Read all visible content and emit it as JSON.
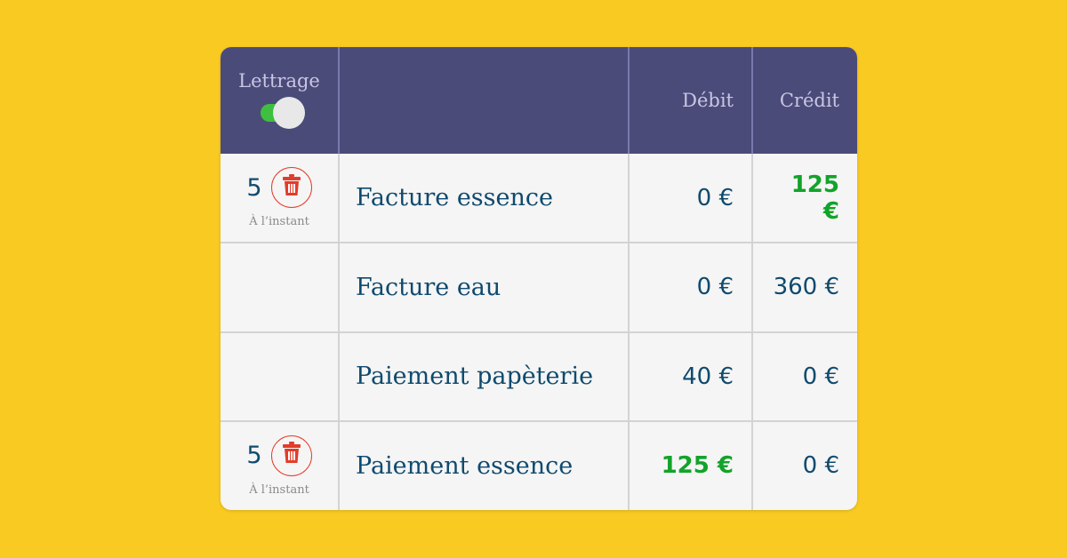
{
  "header": {
    "lettrage_label": "Lettrage",
    "lettrage_toggle_on": true,
    "description_label": "",
    "debit_label": "Débit",
    "credit_label": "Crédit"
  },
  "colors": {
    "background": "#f9ca21",
    "header": "#4b4b7a",
    "highlight_green": "#12a32a",
    "text_blue": "#0f4a6e",
    "delete_red": "#e23c2a",
    "toggle_green": "#3fbf3f"
  },
  "rows": [
    {
      "lettrage": {
        "number": "5",
        "timestamp": "À l’instant",
        "delete_icon": "trash-icon"
      },
      "label": "Facture essence",
      "debit": "0 €",
      "credit": "125 €",
      "highlight": "credit"
    },
    {
      "lettrage": null,
      "label": "Facture eau",
      "debit": "0 €",
      "credit": "360 €",
      "highlight": null
    },
    {
      "lettrage": null,
      "label": "Paiement papèterie",
      "debit": "40 €",
      "credit": "0 €",
      "highlight": null
    },
    {
      "lettrage": {
        "number": "5",
        "timestamp": "À l’instant",
        "delete_icon": "trash-icon"
      },
      "label": "Paiement essence",
      "debit": "125 €",
      "credit": "0 €",
      "highlight": "debit"
    }
  ]
}
